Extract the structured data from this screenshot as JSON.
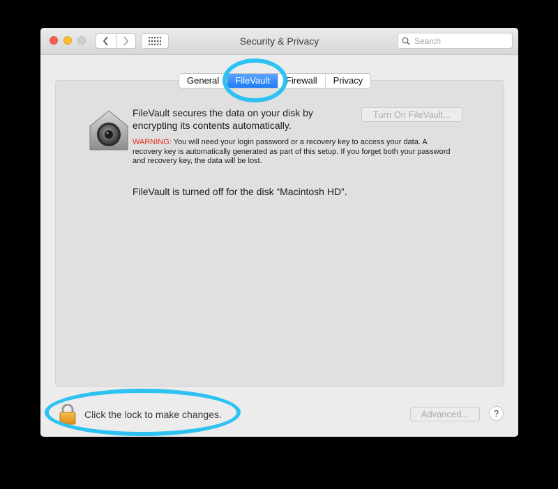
{
  "window": {
    "title": "Security & Privacy",
    "search_placeholder": "Search"
  },
  "tabs": [
    {
      "label": "General",
      "active": false
    },
    {
      "label": "FileVault",
      "active": true
    },
    {
      "label": "Firewall",
      "active": false
    },
    {
      "label": "Privacy",
      "active": false
    }
  ],
  "filevault": {
    "description": "FileVault secures the data on your disk by encrypting its contents automatically.",
    "turn_on_button": "Turn On FileVault...",
    "warning_label": "WARNING:",
    "warning_text": " You will need your login password or a recovery key to access your data. A recovery key is automatically generated as part of this setup. If you forget both your password and recovery key, the data will be lost.",
    "status": "FileVault is turned off for the disk “Macintosh HD”."
  },
  "footer": {
    "lock_text": "Click the lock to make changes.",
    "advanced_button": "Advanced...",
    "help_button": "?"
  },
  "colors": {
    "highlight": "#2ec2f2",
    "active_tab": "#1e7bf5",
    "warning": "#e5291e"
  }
}
